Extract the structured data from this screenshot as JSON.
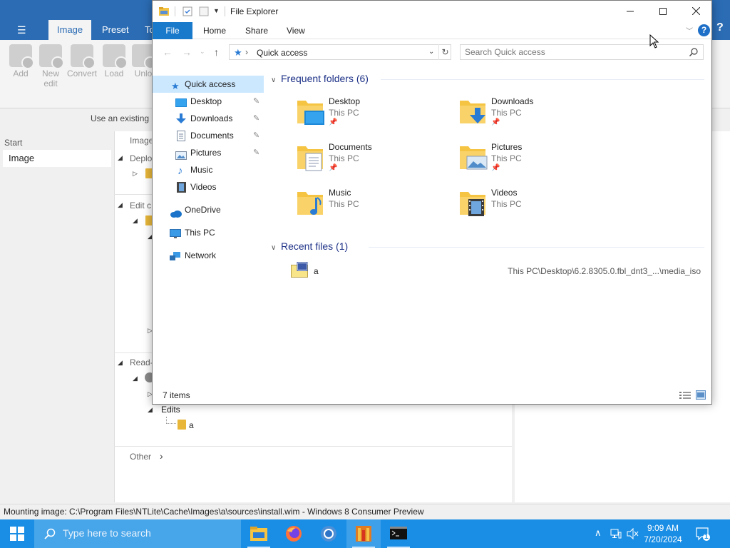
{
  "ntlite": {
    "tabs": [
      "Image",
      "Preset",
      "To"
    ],
    "ribbon_buttons": [
      "Add",
      "New edit",
      "Convert",
      "Load",
      "Unlo"
    ],
    "use_existing": "Use an existing i",
    "start_label": "Start",
    "image_item": "Image",
    "tree": {
      "image_header": "Image",
      "deploy": "Deplo",
      "edit": "Edit c",
      "read": "Read-",
      "edits": "Edits",
      "edits_child": "a",
      "other": "Other"
    },
    "status": "Mounting image: C:\\Program Files\\NTLite\\Cache\\Images\\a\\sources\\install.wim - Windows 8 Consumer Preview"
  },
  "explorer": {
    "title": "File Explorer",
    "tabs": {
      "file": "File",
      "home": "Home",
      "share": "Share",
      "view": "View"
    },
    "address": "Quick access",
    "search_placeholder": "Search Quick access",
    "nav": [
      {
        "label": "Quick access",
        "icon": "star-icon",
        "selected": true
      },
      {
        "label": "Desktop",
        "icon": "desktop-icon",
        "pinned": true
      },
      {
        "label": "Downloads",
        "icon": "download-icon",
        "pinned": true
      },
      {
        "label": "Documents",
        "icon": "document-icon",
        "pinned": true
      },
      {
        "label": "Pictures",
        "icon": "picture-icon",
        "pinned": true
      },
      {
        "label": "Music",
        "icon": "music-icon"
      },
      {
        "label": "Videos",
        "icon": "video-icon"
      },
      {
        "label": "OneDrive",
        "icon": "cloud-icon"
      },
      {
        "label": "This PC",
        "icon": "monitor-icon"
      },
      {
        "label": "Network",
        "icon": "network-icon"
      }
    ],
    "frequent_header": "Frequent folders (6)",
    "folders": [
      {
        "name": "Desktop",
        "location": "This PC",
        "pinned": true
      },
      {
        "name": "Downloads",
        "location": "This PC",
        "pinned": true
      },
      {
        "name": "Documents",
        "location": "This PC",
        "pinned": true
      },
      {
        "name": "Pictures",
        "location": "This PC",
        "pinned": true
      },
      {
        "name": "Music",
        "location": "This PC",
        "pinned": false
      },
      {
        "name": "Videos",
        "location": "This PC",
        "pinned": false
      }
    ],
    "recent_header": "Recent files (1)",
    "recent": [
      {
        "name": "a",
        "path": "This PC\\Desktop\\6.2.8305.0.fbl_dnt3_...\\media_iso",
        "icon": "iso-icon"
      }
    ],
    "item_count": "7 items",
    "pin_glyph": "📌"
  },
  "taskbar": {
    "search_placeholder": "Type here to search",
    "time": "9:09 AM",
    "date": "7/20/2024",
    "notification_count": "1",
    "apps": [
      "file-explorer-icon",
      "firefox-icon",
      "chrome-icon",
      "ntlite-icon",
      "terminal-icon"
    ]
  },
  "colors": {
    "ntlite_blue": "#2b6cb4",
    "explorer_file_tab": "#1979ca",
    "group_header": "#1e3287",
    "taskbar": "#1a8ee5",
    "folder_yellow": "#f5c443"
  }
}
